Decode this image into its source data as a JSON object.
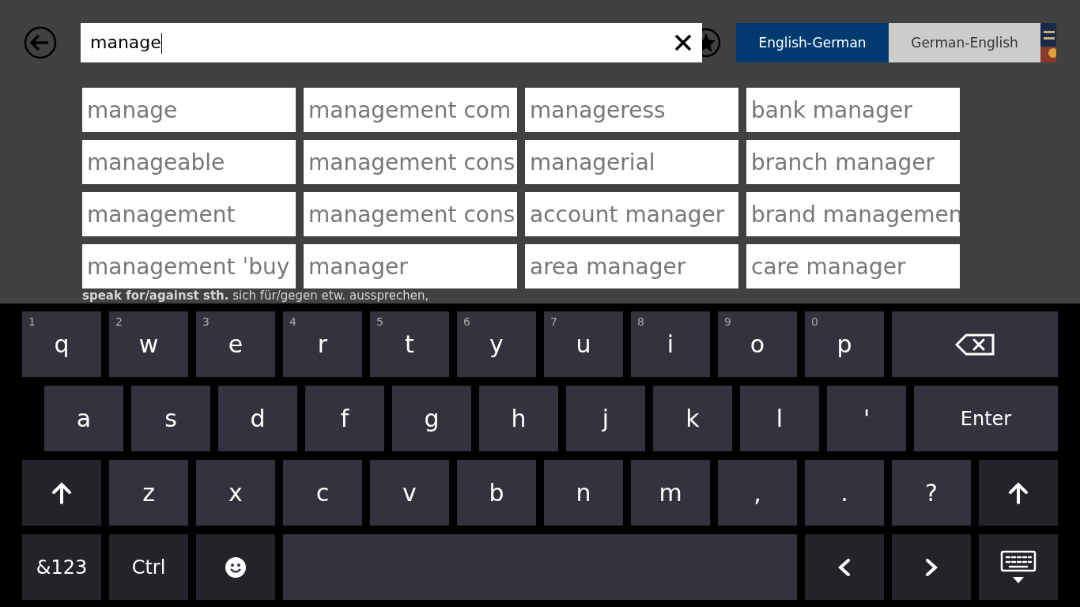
{
  "search": {
    "value": "manage"
  },
  "directions": [
    {
      "label": "English-German",
      "selected": true
    },
    {
      "label": "German-English",
      "selected": false
    }
  ],
  "entry_lines": [
    {
      "text": "**speak for/against sth.** sich für/gegen etw. aussprechen,"
    }
  ],
  "suggestions": [
    [
      "manage",
      "manageable",
      "management",
      "management ˈbuy"
    ],
    [
      "management com",
      "management cons",
      "management cons",
      "manager"
    ],
    [
      "manageress",
      "managerial",
      "account manager",
      "area manager"
    ],
    [
      "bank manager",
      "branch manager",
      "brand managemen",
      "care manager"
    ]
  ],
  "keyboard": {
    "rows": [
      [
        {
          "kind": "char",
          "label": "q",
          "hint": "1"
        },
        {
          "kind": "char",
          "label": "w",
          "hint": "2"
        },
        {
          "kind": "char",
          "label": "e",
          "hint": "3"
        },
        {
          "kind": "char",
          "label": "r",
          "hint": "4"
        },
        {
          "kind": "char",
          "label": "t",
          "hint": "5"
        },
        {
          "kind": "char",
          "label": "y",
          "hint": "6"
        },
        {
          "kind": "char",
          "label": "u",
          "hint": "7"
        },
        {
          "kind": "char",
          "label": "i",
          "hint": "8"
        },
        {
          "kind": "char",
          "label": "o",
          "hint": "9"
        },
        {
          "kind": "char",
          "label": "p",
          "hint": "0"
        },
        {
          "kind": "backspace"
        }
      ],
      [
        {
          "kind": "char",
          "label": "a"
        },
        {
          "kind": "char",
          "label": "s"
        },
        {
          "kind": "char",
          "label": "d"
        },
        {
          "kind": "char",
          "label": "f"
        },
        {
          "kind": "char",
          "label": "g"
        },
        {
          "kind": "char",
          "label": "h"
        },
        {
          "kind": "char",
          "label": "j"
        },
        {
          "kind": "char",
          "label": "k"
        },
        {
          "kind": "char",
          "label": "l"
        },
        {
          "kind": "char",
          "label": "'"
        },
        {
          "kind": "wide",
          "label": "Enter"
        }
      ],
      [
        {
          "kind": "shift"
        },
        {
          "kind": "char",
          "label": "z"
        },
        {
          "kind": "char",
          "label": "x"
        },
        {
          "kind": "char",
          "label": "c"
        },
        {
          "kind": "char",
          "label": "v"
        },
        {
          "kind": "char",
          "label": "b"
        },
        {
          "kind": "char",
          "label": "n"
        },
        {
          "kind": "char",
          "label": "m"
        },
        {
          "kind": "char",
          "label": ","
        },
        {
          "kind": "char",
          "label": "."
        },
        {
          "kind": "char",
          "label": "?"
        },
        {
          "kind": "shift"
        }
      ],
      [
        {
          "kind": "fn",
          "label": "&123"
        },
        {
          "kind": "fn",
          "label": "Ctrl"
        },
        {
          "kind": "emoji"
        },
        {
          "kind": "space"
        },
        {
          "kind": "left"
        },
        {
          "kind": "right"
        },
        {
          "kind": "hide"
        }
      ]
    ]
  }
}
